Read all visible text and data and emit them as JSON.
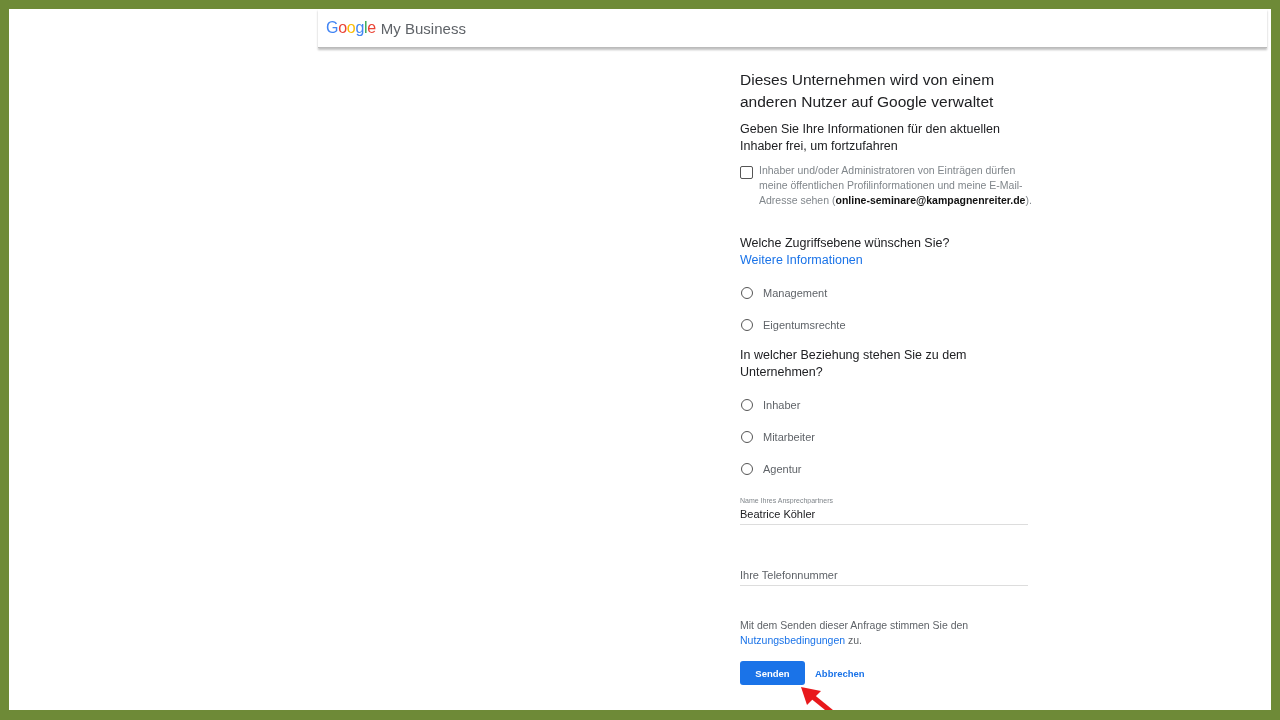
{
  "header": {
    "logo": "Google",
    "product": "My Business"
  },
  "title": "Dieses Unternehmen wird von einem anderen Nutzer auf Google verwaltet",
  "subtitle": "Geben Sie Ihre Informationen für den aktuellen Inhaber frei, um fortzufahren",
  "consent": {
    "text": "Inhaber und/oder Administratoren von Einträgen dürfen meine öffentlichen Profilinformationen und meine E-Mail-Adresse sehen (**online-seminare@kampagnenreiter.de**).",
    "checked": false
  },
  "access": {
    "question": "Welche Zugriffsebene wünschen Sie?",
    "link": "Weitere Informationen",
    "options": [
      {
        "label": "Management",
        "selected": false
      },
      {
        "label": "Eigentumsrechte",
        "selected": false
      }
    ]
  },
  "relation": {
    "question": "In welcher Beziehung stehen Sie zu dem Unternehmen?",
    "options": [
      {
        "label": "Inhaber",
        "selected": false
      },
      {
        "label": "Mitarbeiter",
        "selected": false
      },
      {
        "label": "Agentur",
        "selected": false
      }
    ]
  },
  "fields": [
    {
      "label": "Name Ihres Ansprechpartners",
      "value": "Beatrice Köhler"
    },
    {
      "placeholder": "Ihre Telefonnummer"
    }
  ],
  "terms": {
    "before": "Mit dem Senden dieser Anfrage stimmen Sie den",
    "link": "Nutzungsbedingungen",
    "after": "zu."
  },
  "buttons": {
    "submit": "Senden",
    "cancel": "Abbrechen"
  }
}
